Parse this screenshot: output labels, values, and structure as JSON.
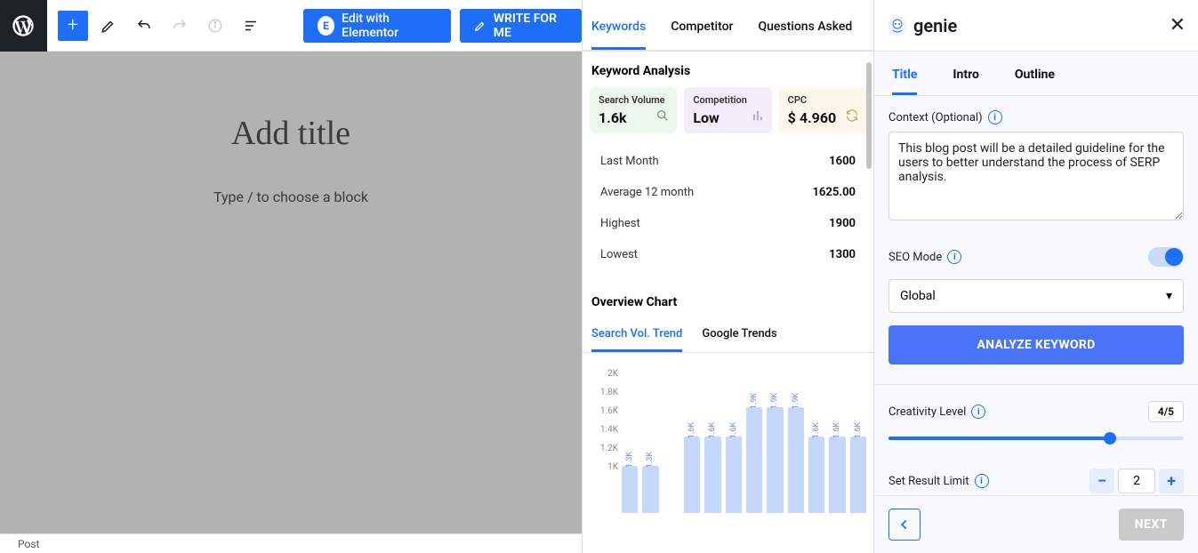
{
  "toolbar": {
    "elementor_label": "Edit with Elementor",
    "write_for_me_label": "WRITE FOR ME"
  },
  "editor": {
    "title_placeholder": "Add title",
    "block_hint": "Type / to choose a block"
  },
  "statusbar": {
    "mode": "Post"
  },
  "mid": {
    "tabs": [
      "Keywords",
      "Competitor",
      "Questions Asked"
    ],
    "active_tab_index": 0,
    "section_keyword_analysis": "Keyword Analysis",
    "cards": {
      "search_volume_label": "Search Volume",
      "search_volume_value": "1.6k",
      "competition_label": "Competition",
      "competition_value": "Low",
      "cpc_label": "CPC",
      "cpc_value": "$ 4.960"
    },
    "stats": [
      {
        "k": "Last Month",
        "v": "1600"
      },
      {
        "k": "Average 12 month",
        "v": "1625.00"
      },
      {
        "k": "Highest",
        "v": "1900"
      },
      {
        "k": "Lowest",
        "v": "1300"
      }
    ],
    "section_overview_chart": "Overview Chart",
    "chart_tabs": [
      "Search Vol. Trend",
      "Google Trends"
    ],
    "chart_active_tab_index": 0
  },
  "chart_data": {
    "type": "bar",
    "categories": [
      "",
      "",
      "",
      "",
      "",
      "",
      "",
      "",
      "",
      "",
      "",
      ""
    ],
    "value_labels": [
      "1.3K",
      "1.3K",
      "",
      "1.6K",
      "1.6K",
      "1.6K",
      "1.9K",
      "1.9K",
      "1.9K",
      "1.6K",
      "1.6K",
      "1.6K"
    ],
    "values": [
      1300,
      1300,
      0,
      1600,
      1600,
      1600,
      1900,
      1900,
      1900,
      1600,
      1600,
      1600
    ],
    "y_ticks": [
      "2K",
      "1.8K",
      "1.6K",
      "1.4K",
      "1.2K",
      "1K"
    ],
    "ylim": [
      1000,
      2000
    ],
    "xlabel": "",
    "ylabel": ""
  },
  "right": {
    "brand": "genie",
    "tabs": [
      "Title",
      "Intro",
      "Outline"
    ],
    "active_tab_index": 0,
    "context_label": "Context (Optional)",
    "context_value": "This blog post will be a detailed guideline for the users to better understand the process of SERP analysis.",
    "seo_mode_label": "SEO Mode",
    "seo_mode_on": true,
    "region_options_selected": "Global",
    "analyze_btn": "ANALYZE KEYWORD",
    "creativity_label": "Creativity Level",
    "creativity_value": "4/5",
    "creativity_fraction": 0.75,
    "result_limit_label": "Set Result Limit",
    "result_limit_value": "2",
    "next_label": "NEXT"
  }
}
